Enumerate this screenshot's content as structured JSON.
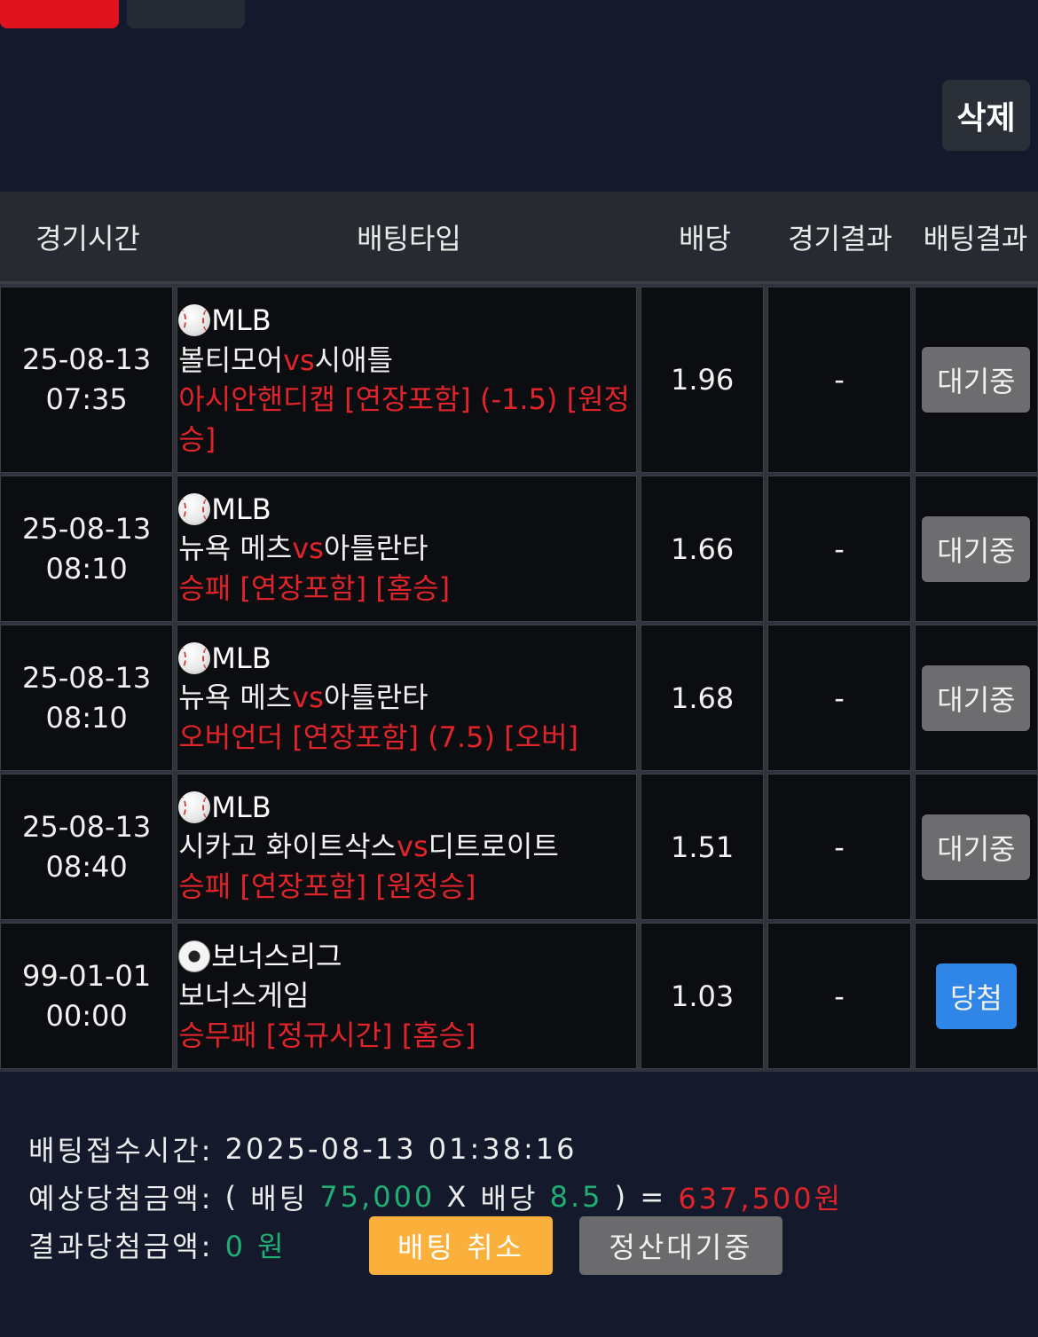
{
  "header": {
    "delete_label": "삭제"
  },
  "table": {
    "columns": [
      "경기시간",
      "배팅타입",
      "배당",
      "경기결과",
      "배팅결과"
    ],
    "rows": [
      {
        "date": "25-08-13",
        "time": "07:35",
        "sport_icon": "baseball-icon",
        "league": "MLB",
        "home": "볼티모어",
        "vs": "vs",
        "away": "시애틀",
        "pick": "아시안핸디캡 [연장포함] (-1.5) [원정승]",
        "odds": "1.96",
        "result": "-",
        "status": "대기중",
        "status_type": "wait"
      },
      {
        "date": "25-08-13",
        "time": "08:10",
        "sport_icon": "baseball-icon",
        "league": "MLB",
        "home": "뉴욕 메츠",
        "vs": "vs",
        "away": "아틀란타",
        "pick": "승패 [연장포함] [홈승]",
        "odds": "1.66",
        "result": "-",
        "status": "대기중",
        "status_type": "wait"
      },
      {
        "date": "25-08-13",
        "time": "08:10",
        "sport_icon": "baseball-icon",
        "league": "MLB",
        "home": "뉴욕 메츠",
        "vs": "vs",
        "away": "아틀란타",
        "pick": "오버언더 [연장포함] (7.5) [오버]",
        "odds": "1.68",
        "result": "-",
        "status": "대기중",
        "status_type": "wait"
      },
      {
        "date": "25-08-13",
        "time": "08:40",
        "sport_icon": "baseball-icon",
        "league": "MLB",
        "home": "시카고 화이트삭스",
        "vs": "vs",
        "away": "디트로이트",
        "pick": "승패 [연장포함] [원정승]",
        "odds": "1.51",
        "result": "-",
        "status": "대기중",
        "status_type": "wait"
      },
      {
        "date": "99-01-01",
        "time": "00:00",
        "sport_icon": "soccer-ball-icon",
        "league": "보너스리그",
        "home": "보너스게임",
        "vs": "",
        "away": "",
        "pick": "승무패 [정규시간] [홈승]",
        "odds": "1.03",
        "result": "-",
        "status": "당첨",
        "status_type": "win"
      }
    ]
  },
  "summary": {
    "bet_time_label": "배팅접수시간:",
    "bet_time_value": "2025-08-13 01:38:16",
    "expected_label": "예상당첨금액:",
    "paren_open": "(",
    "bet_label": "배팅",
    "bet_amount": "75,000",
    "x": "X",
    "odds_label": "배당",
    "total_odds": "8.5",
    "paren_close": ")",
    "equals": "=",
    "expected_amount": "637,500원",
    "result_label": "결과당첨금액:",
    "result_amount": "0 원",
    "cancel_label": "배팅 취소",
    "settle_label": "정산대기중"
  },
  "colors": {
    "accent_red": "#e0242a",
    "accent_green": "#1fae73",
    "cancel_orange": "#fbb03b",
    "win_blue": "#2f86e6"
  }
}
